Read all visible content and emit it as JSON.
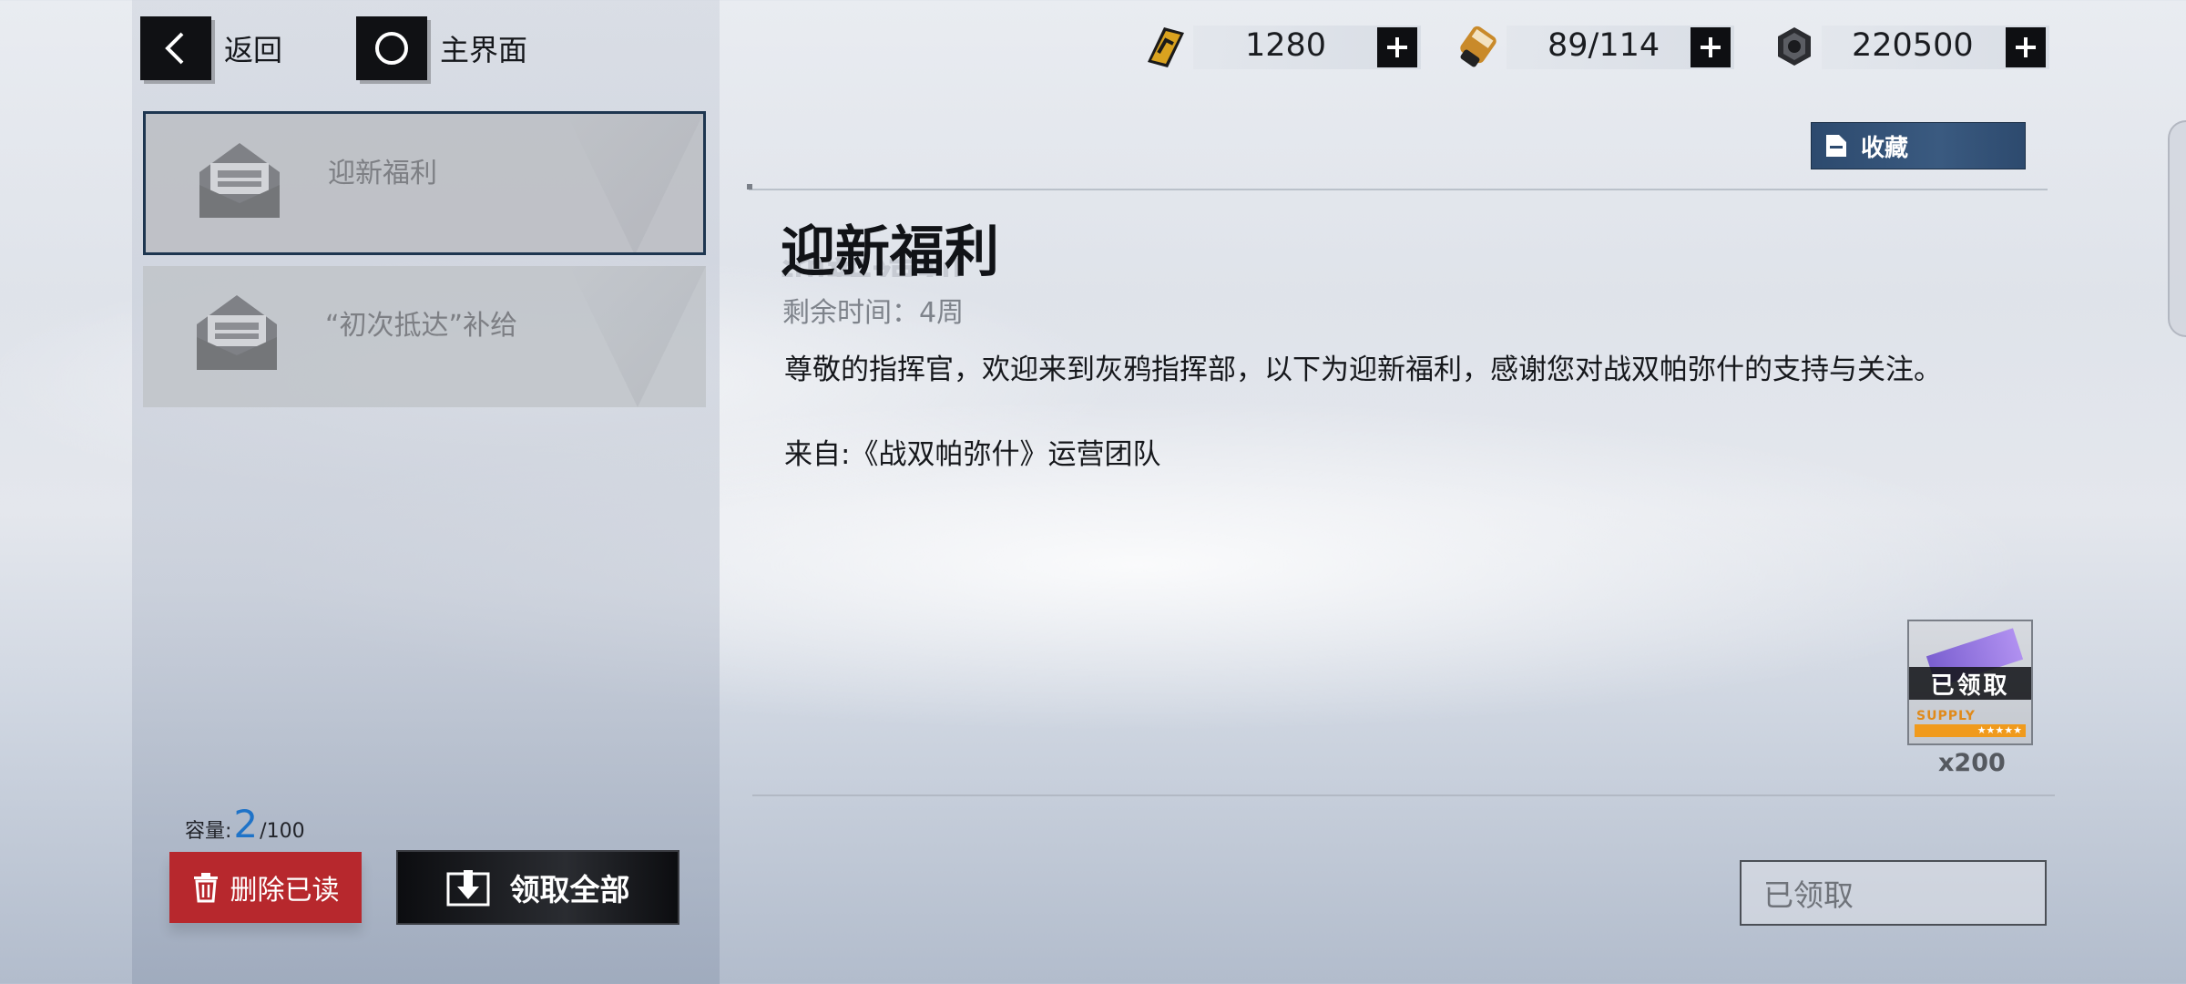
{
  "nav": {
    "back_label": "返回",
    "home_label": "主界面"
  },
  "resources": [
    {
      "icon": "gold-bar-icon",
      "value": "1280"
    },
    {
      "icon": "stamina-canister-icon",
      "value": "89/114"
    },
    {
      "icon": "cog-coin-icon",
      "value": "220500"
    }
  ],
  "mail_list": [
    {
      "title": "迎新福利",
      "selected": true
    },
    {
      "title": "“初次抵达”补给",
      "selected": false
    }
  ],
  "capacity": {
    "label": "容量:",
    "current": "2",
    "max": "/100"
  },
  "actions": {
    "delete_read_label": "删除已读",
    "claim_all_label": "领取全部"
  },
  "detail": {
    "favorite_label": "收藏",
    "title": "迎新福利",
    "remaining": "剩余时间：4周",
    "body": "尊敬的指挥官，欢迎来到灰鸦指挥部，以下为迎新福利，感谢您对战双帕弥什的支持与关注。",
    "from": "来自:《战双帕弥什》运营团队",
    "reward": {
      "status_tag": "已领取",
      "supply_text": "SUPPLY",
      "stars": "★★★★★",
      "quantity": "x200"
    },
    "claim_button_label": "已领取"
  },
  "colors": {
    "accent_blue": "#1f73c8",
    "delete_red": "#b7282d",
    "favorite_blue": "#2d4a6e",
    "selected_border": "#1e3650"
  }
}
